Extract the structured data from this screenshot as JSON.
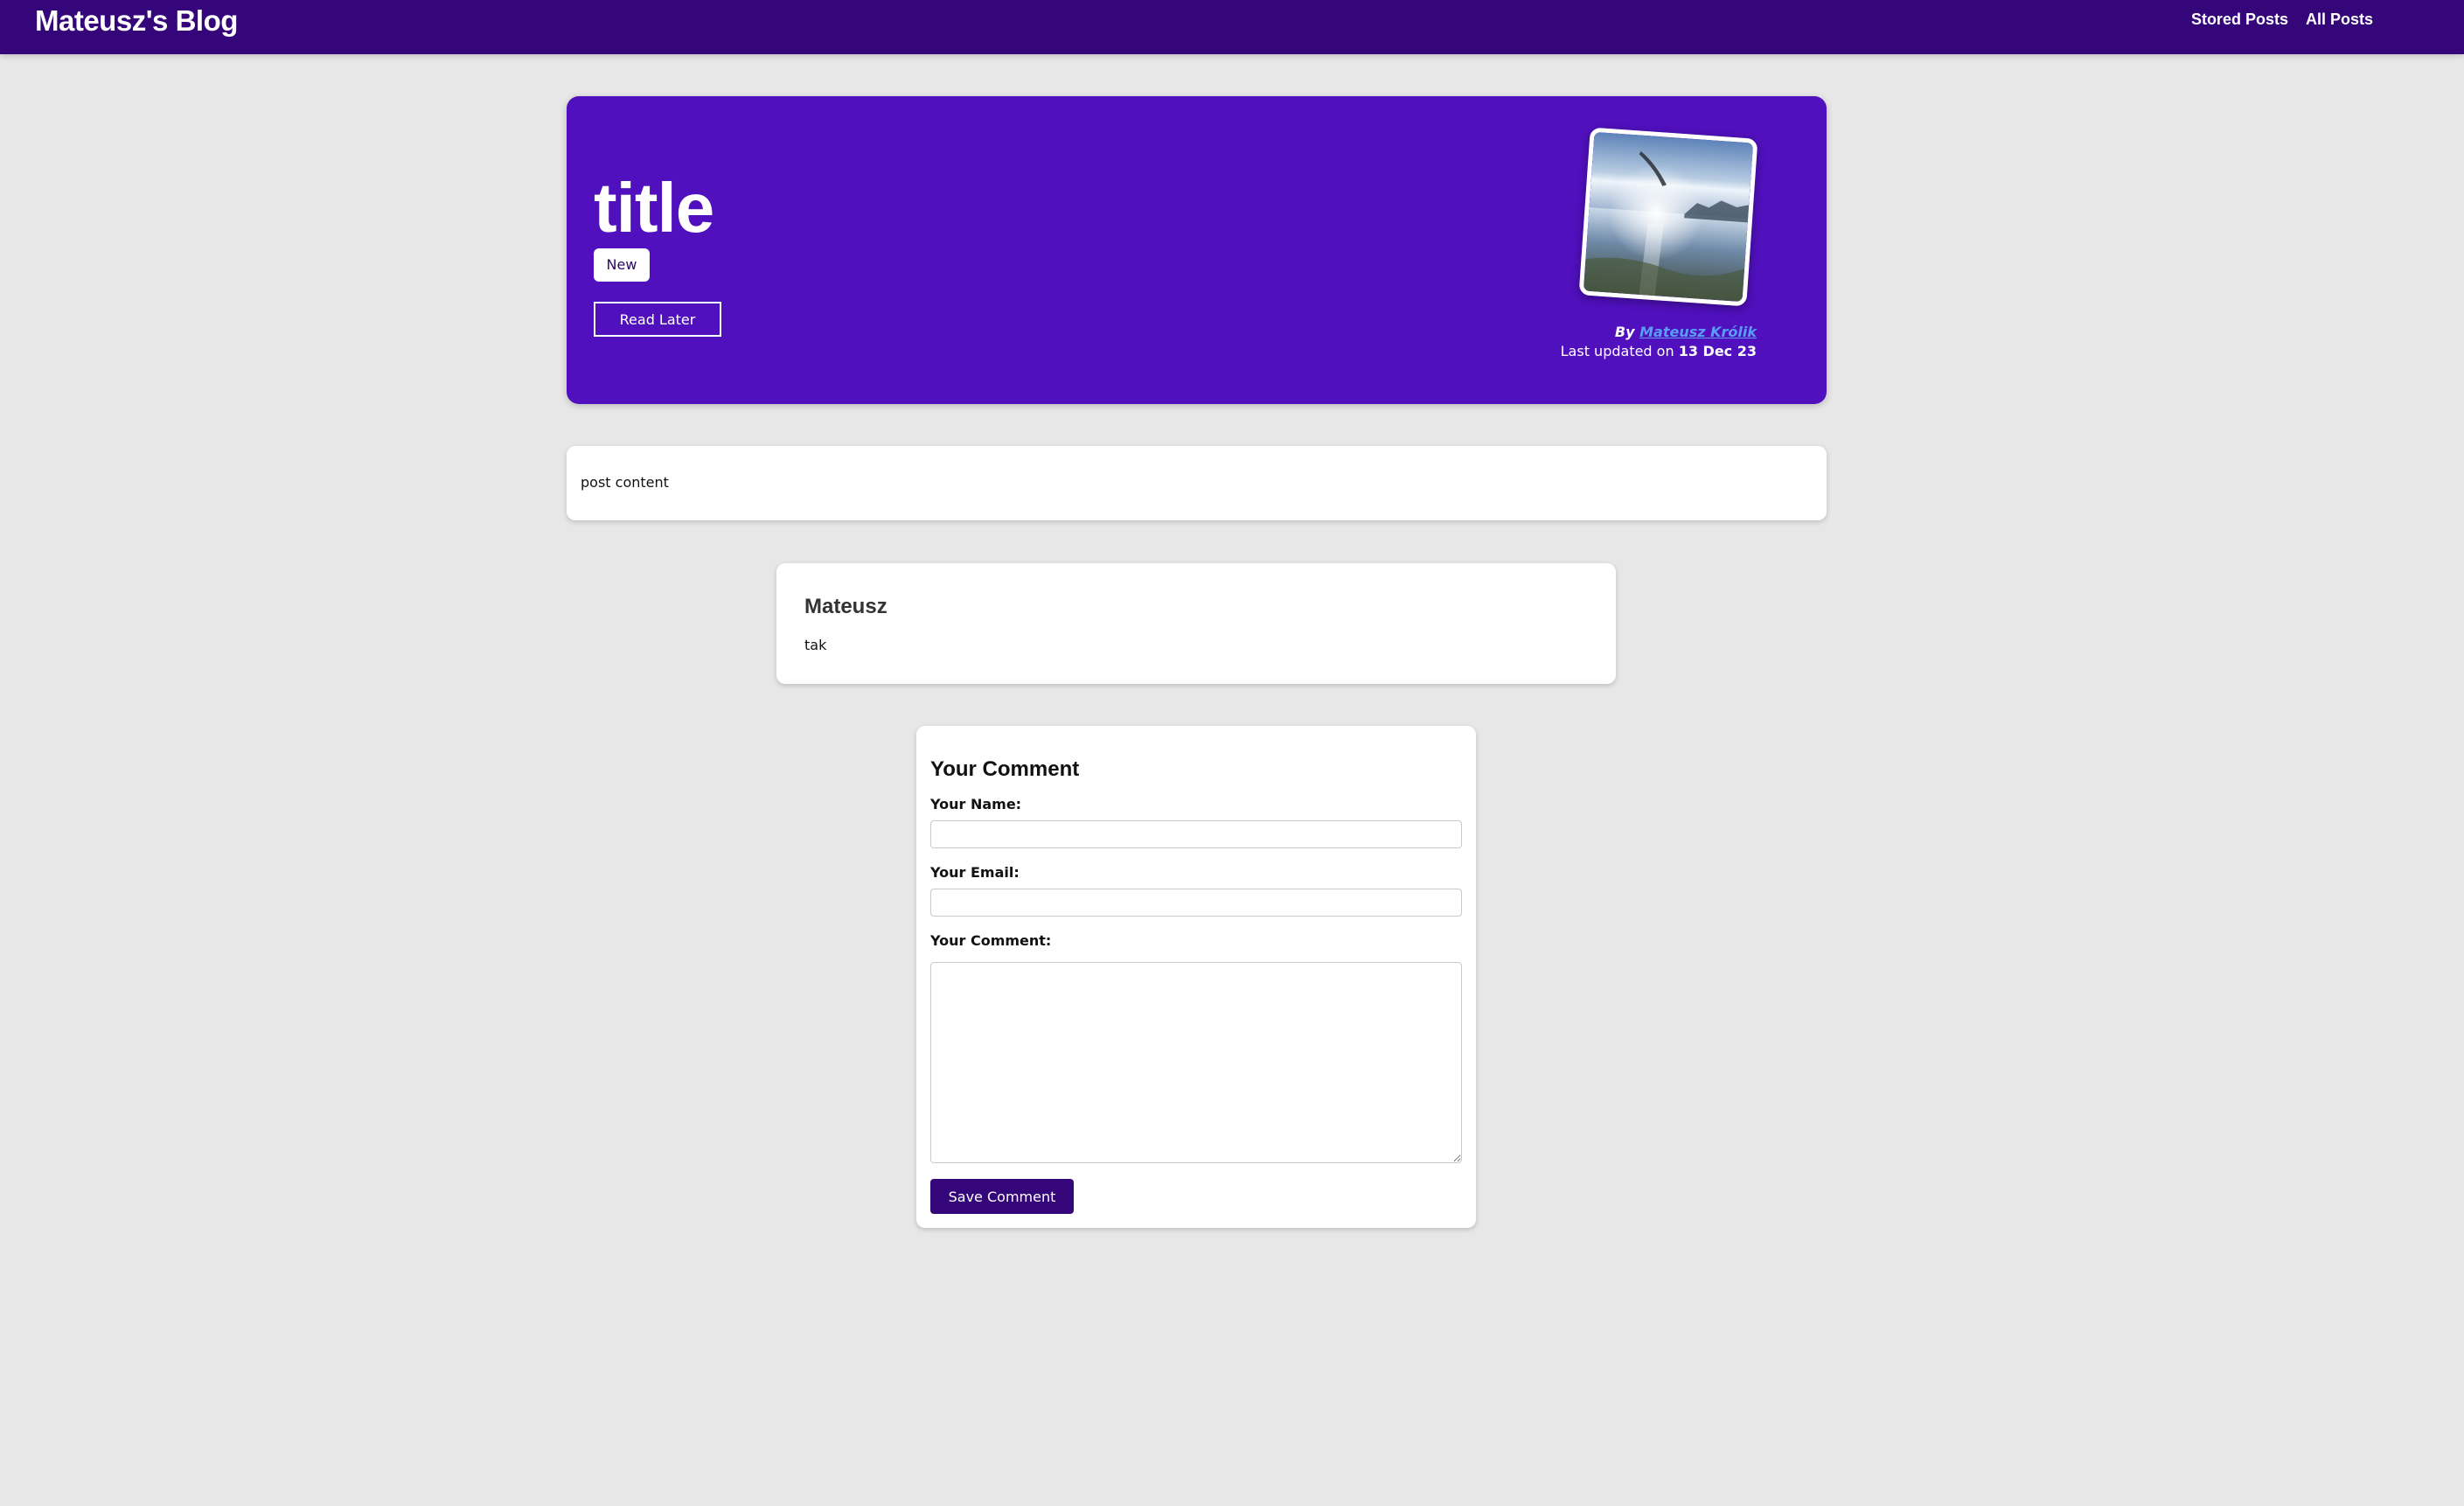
{
  "header": {
    "brand": "Mateusz's Blog",
    "nav": [
      {
        "label": "Stored Posts"
      },
      {
        "label": "All Posts"
      }
    ]
  },
  "hero": {
    "title": "title",
    "tag": "New",
    "read_later_label": "Read Later",
    "author_photo_icon": "author-photo",
    "byline_prefix": "By",
    "author_name": "Mateusz Królik",
    "updated_prefix": "Last updated on",
    "updated_date": "13 Dec 23"
  },
  "post": {
    "content": "post content"
  },
  "comments": [
    {
      "author": "Mateusz",
      "text": "tak"
    }
  ],
  "comment_form": {
    "title": "Your Comment",
    "name_label": "Your Name:",
    "name_value": "",
    "email_label": "Your Email:",
    "email_value": "",
    "comment_label": "Your Comment:",
    "comment_value": "",
    "save_label": "Save Comment"
  },
  "colors": {
    "nav_bg": "#35067a",
    "hero_bg": "#5010bd",
    "page_bg": "#e8e7e7",
    "link": "#5a9df5",
    "button_bg": "#35067a"
  }
}
